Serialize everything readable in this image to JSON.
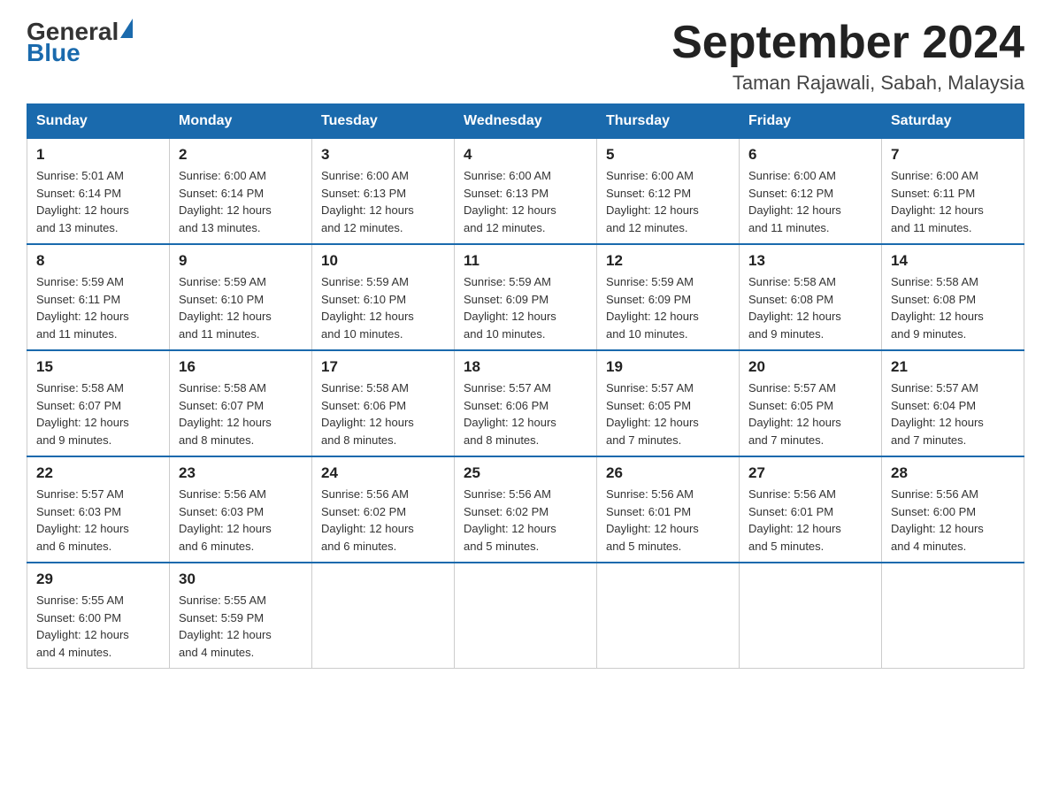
{
  "logo": {
    "general": "General",
    "triangle": "▶",
    "blue": "Blue"
  },
  "header": {
    "title": "September 2024",
    "subtitle": "Taman Rajawali, Sabah, Malaysia"
  },
  "days_of_week": [
    "Sunday",
    "Monday",
    "Tuesday",
    "Wednesday",
    "Thursday",
    "Friday",
    "Saturday"
  ],
  "weeks": [
    [
      {
        "day": "1",
        "sunrise": "5:01 AM",
        "sunset": "6:14 PM",
        "daylight": "12 hours and 13 minutes."
      },
      {
        "day": "2",
        "sunrise": "6:00 AM",
        "sunset": "6:14 PM",
        "daylight": "12 hours and 13 minutes."
      },
      {
        "day": "3",
        "sunrise": "6:00 AM",
        "sunset": "6:13 PM",
        "daylight": "12 hours and 12 minutes."
      },
      {
        "day": "4",
        "sunrise": "6:00 AM",
        "sunset": "6:13 PM",
        "daylight": "12 hours and 12 minutes."
      },
      {
        "day": "5",
        "sunrise": "6:00 AM",
        "sunset": "6:12 PM",
        "daylight": "12 hours and 12 minutes."
      },
      {
        "day": "6",
        "sunrise": "6:00 AM",
        "sunset": "6:12 PM",
        "daylight": "12 hours and 11 minutes."
      },
      {
        "day": "7",
        "sunrise": "6:00 AM",
        "sunset": "6:11 PM",
        "daylight": "12 hours and 11 minutes."
      }
    ],
    [
      {
        "day": "8",
        "sunrise": "5:59 AM",
        "sunset": "6:11 PM",
        "daylight": "12 hours and 11 minutes."
      },
      {
        "day": "9",
        "sunrise": "5:59 AM",
        "sunset": "6:10 PM",
        "daylight": "12 hours and 11 minutes."
      },
      {
        "day": "10",
        "sunrise": "5:59 AM",
        "sunset": "6:10 PM",
        "daylight": "12 hours and 10 minutes."
      },
      {
        "day": "11",
        "sunrise": "5:59 AM",
        "sunset": "6:09 PM",
        "daylight": "12 hours and 10 minutes."
      },
      {
        "day": "12",
        "sunrise": "5:59 AM",
        "sunset": "6:09 PM",
        "daylight": "12 hours and 10 minutes."
      },
      {
        "day": "13",
        "sunrise": "5:58 AM",
        "sunset": "6:08 PM",
        "daylight": "12 hours and 9 minutes."
      },
      {
        "day": "14",
        "sunrise": "5:58 AM",
        "sunset": "6:08 PM",
        "daylight": "12 hours and 9 minutes."
      }
    ],
    [
      {
        "day": "15",
        "sunrise": "5:58 AM",
        "sunset": "6:07 PM",
        "daylight": "12 hours and 9 minutes."
      },
      {
        "day": "16",
        "sunrise": "5:58 AM",
        "sunset": "6:07 PM",
        "daylight": "12 hours and 8 minutes."
      },
      {
        "day": "17",
        "sunrise": "5:58 AM",
        "sunset": "6:06 PM",
        "daylight": "12 hours and 8 minutes."
      },
      {
        "day": "18",
        "sunrise": "5:57 AM",
        "sunset": "6:06 PM",
        "daylight": "12 hours and 8 minutes."
      },
      {
        "day": "19",
        "sunrise": "5:57 AM",
        "sunset": "6:05 PM",
        "daylight": "12 hours and 7 minutes."
      },
      {
        "day": "20",
        "sunrise": "5:57 AM",
        "sunset": "6:05 PM",
        "daylight": "12 hours and 7 minutes."
      },
      {
        "day": "21",
        "sunrise": "5:57 AM",
        "sunset": "6:04 PM",
        "daylight": "12 hours and 7 minutes."
      }
    ],
    [
      {
        "day": "22",
        "sunrise": "5:57 AM",
        "sunset": "6:03 PM",
        "daylight": "12 hours and 6 minutes."
      },
      {
        "day": "23",
        "sunrise": "5:56 AM",
        "sunset": "6:03 PM",
        "daylight": "12 hours and 6 minutes."
      },
      {
        "day": "24",
        "sunrise": "5:56 AM",
        "sunset": "6:02 PM",
        "daylight": "12 hours and 6 minutes."
      },
      {
        "day": "25",
        "sunrise": "5:56 AM",
        "sunset": "6:02 PM",
        "daylight": "12 hours and 5 minutes."
      },
      {
        "day": "26",
        "sunrise": "5:56 AM",
        "sunset": "6:01 PM",
        "daylight": "12 hours and 5 minutes."
      },
      {
        "day": "27",
        "sunrise": "5:56 AM",
        "sunset": "6:01 PM",
        "daylight": "12 hours and 5 minutes."
      },
      {
        "day": "28",
        "sunrise": "5:56 AM",
        "sunset": "6:00 PM",
        "daylight": "12 hours and 4 minutes."
      }
    ],
    [
      {
        "day": "29",
        "sunrise": "5:55 AM",
        "sunset": "6:00 PM",
        "daylight": "12 hours and 4 minutes."
      },
      {
        "day": "30",
        "sunrise": "5:55 AM",
        "sunset": "5:59 PM",
        "daylight": "12 hours and 4 minutes."
      },
      null,
      null,
      null,
      null,
      null
    ]
  ]
}
